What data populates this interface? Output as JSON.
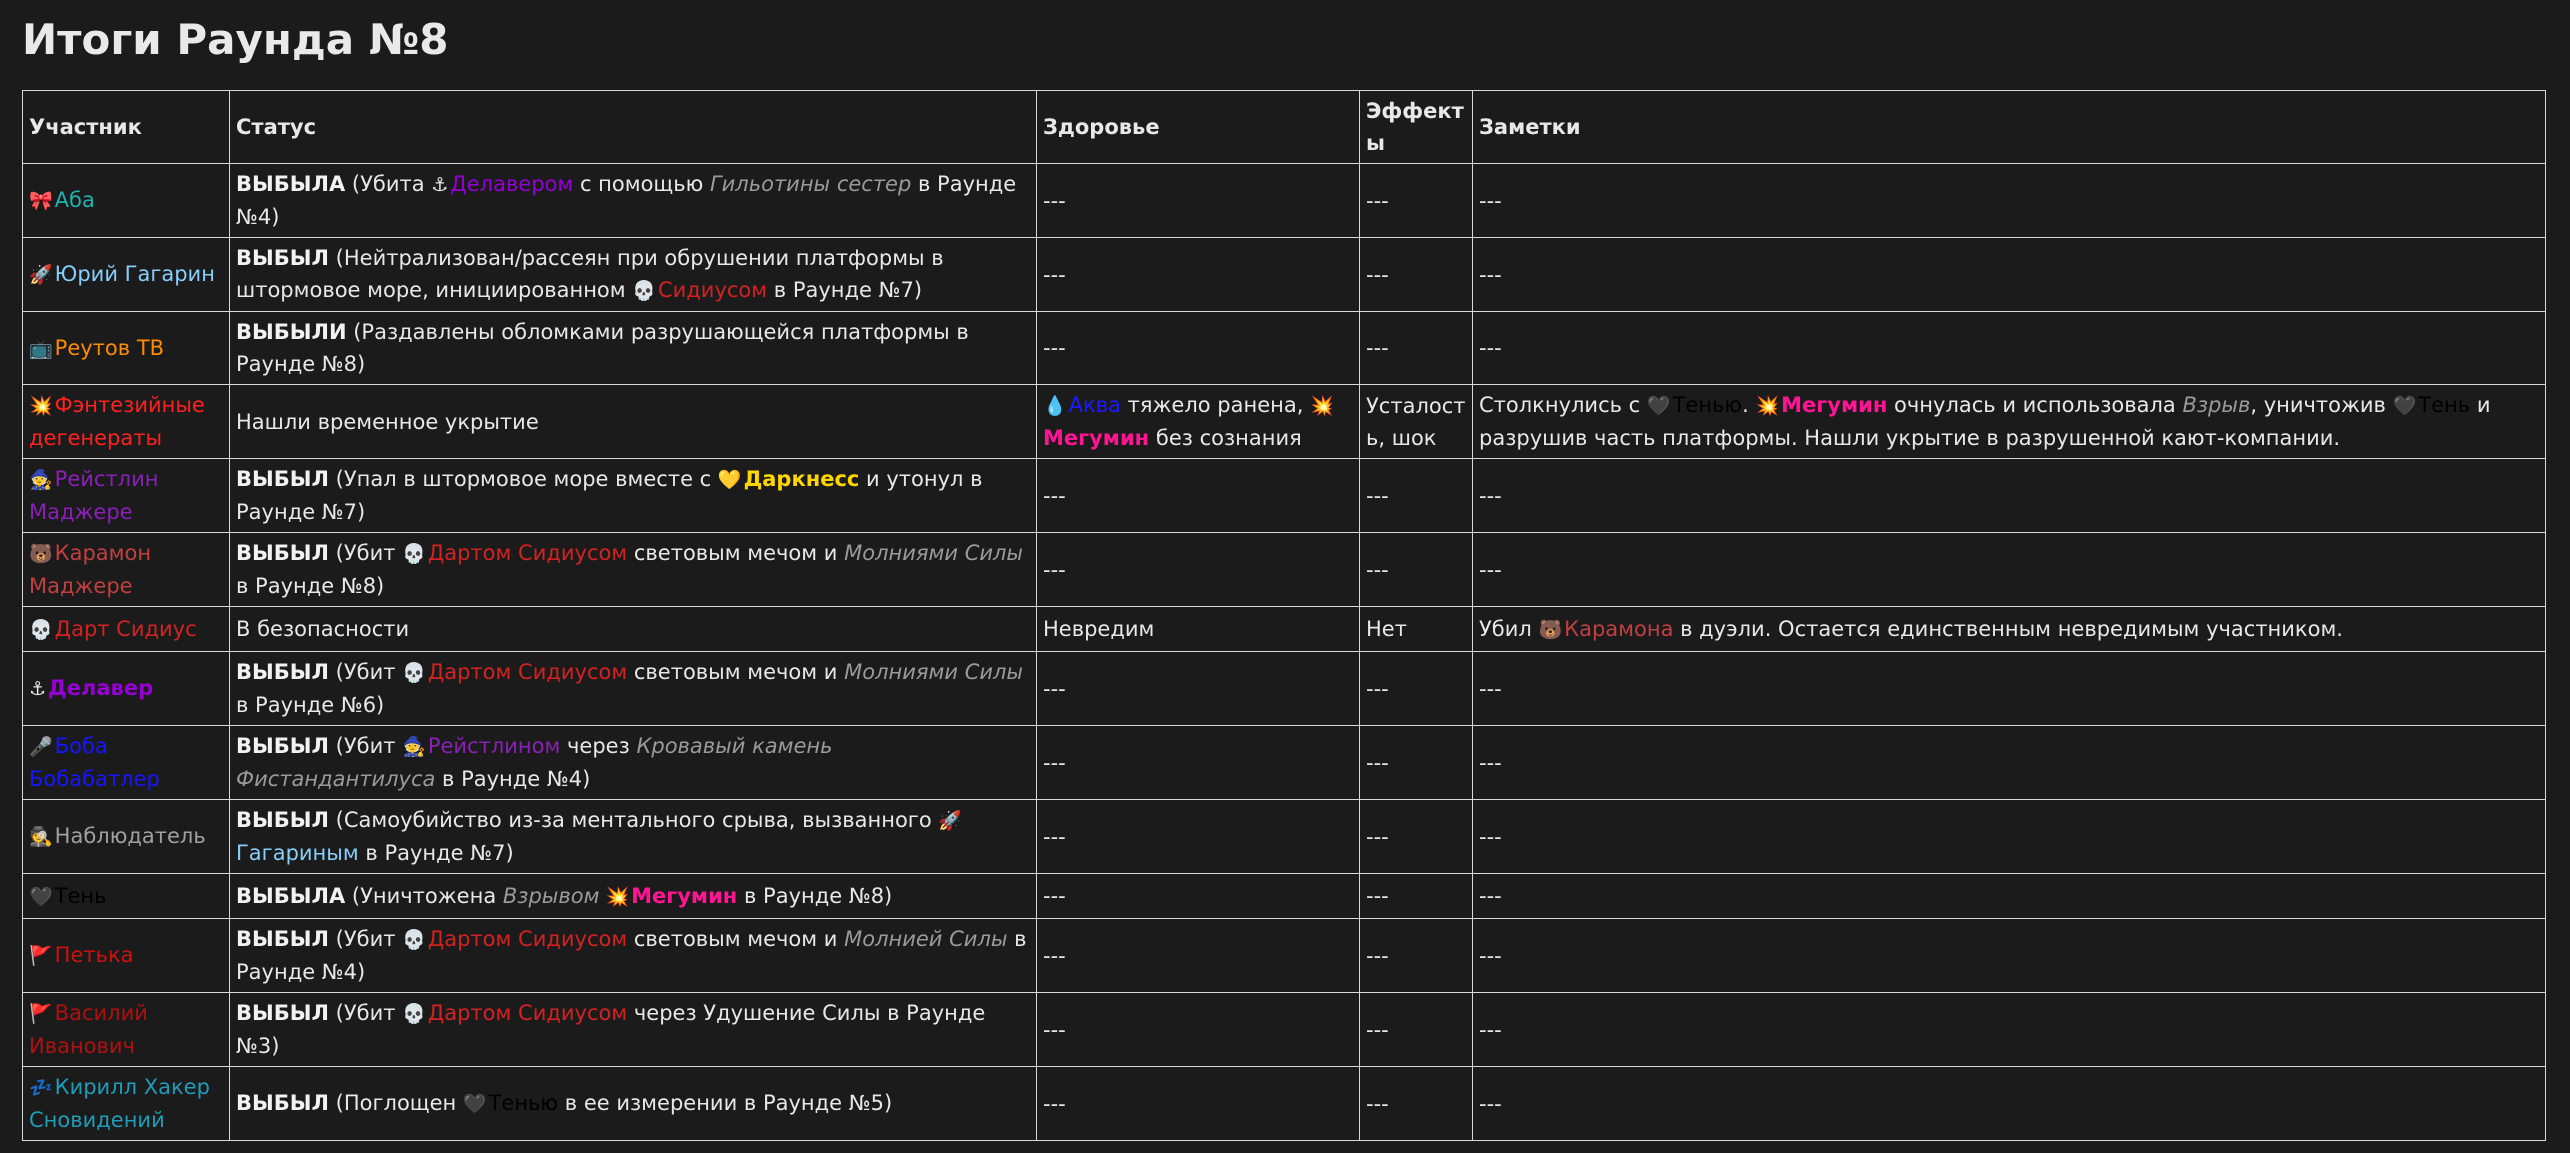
{
  "title": "Итоги Раунда №8",
  "columns": [
    "Участник",
    "Статус",
    "Здоровье",
    "Эффекты",
    "Заметки"
  ],
  "colors": {
    "aba": "#20b2aa",
    "gagarin": "#87cefa",
    "reutov": "#ff8c00",
    "fantasy": "#ff2020",
    "raistlin": "#8b1fb8",
    "caramon": "#c04040",
    "sidious": "#d42222",
    "delaver": "#9400d3",
    "boba": "#1515ff",
    "observer": "#a0a0a0",
    "shadow": "#000000",
    "petka": "#cc1111",
    "vasily": "#b01010",
    "kirill": "#1e9cb8",
    "aqua": "#1a1aff",
    "megumin": "#ff1493",
    "darkness": "#ffd700"
  },
  "rows": [
    {
      "name": {
        "icon": "🎀",
        "icon_name": "ribbon-icon",
        "text": "Аба"
      },
      "status": {
        "s1": "ВЫБЫЛА",
        "s2": " (Убита ",
        "s3_icon": "⚓",
        "s3": "Делавером",
        "s4": " с помощью ",
        "s5": "Гильотины сестер",
        "s6": " в Раунде №4)"
      },
      "health": "---",
      "effects": "---",
      "notes": "---"
    },
    {
      "name": {
        "icon": "🚀",
        "icon_name": "rocket-icon",
        "text": "Юрий Гагарин"
      },
      "status": {
        "s1": "ВЫБЫЛ",
        "s2": " (Нейтрализован/рассеян при обрушении платформы в штормовое море, инициированном ",
        "s3_icon": "💀",
        "s3": "Сидиусом",
        "s4": " в Раунде №7)"
      },
      "health": "---",
      "effects": "---",
      "notes": "---"
    },
    {
      "name": {
        "icon": "📺",
        "icon_name": "tv-icon",
        "text": "Реутов ТВ"
      },
      "status": {
        "s1": "ВЫБЫЛИ",
        "s2": " (Раздавлены обломками разрушающейся платформы в Раунде №8)"
      },
      "health": "---",
      "effects": "---",
      "notes": "---"
    },
    {
      "name": {
        "icon": "💥",
        "icon_name": "explosion-icon",
        "text": "Фэнтезийные дегенераты"
      },
      "status": {
        "s1": "Нашли временное укрытие"
      },
      "health": {
        "h1_icon": "💧",
        "h1": "Аква",
        "h2": " тяжело ранена, ",
        "h3_icon": "💥",
        "h3": "Мегумин",
        "h4": " без сознания"
      },
      "effects": "Усталость, шок",
      "notes": {
        "n1": "Столкнулись с ",
        "n2_icon": "🖤",
        "n2": "Тенью",
        "n3": ". ",
        "n4_icon": "💥",
        "n4": "Мегумин",
        "n5": " очнулась и использовала ",
        "n6": "Взрыв",
        "n7": ", уничтожив ",
        "n8_icon": "🖤",
        "n8": "Тень",
        "n9": " и разрушив часть платформы. Нашли укрытие в разрушенной кают-компании."
      }
    },
    {
      "name": {
        "icon": "🧙",
        "icon_name": "wizard-icon",
        "text": "Рейстлин Маджере"
      },
      "status": {
        "s1": "ВЫБЫЛ",
        "s2": " (Упал в штормовое море вместе с ",
        "s3_icon": "💛",
        "s3": "Даркнесс",
        "s4": " и утонул в Раунде №7)"
      },
      "health": "---",
      "effects": "---",
      "notes": "---"
    },
    {
      "name": {
        "icon": "🐻",
        "icon_name": "bear-icon",
        "text": "Карамон Маджере"
      },
      "status": {
        "s1": "ВЫБЫЛ",
        "s2": " (Убит ",
        "s3_icon": "💀",
        "s3": "Дартом Сидиусом",
        "s4": " световым мечом и ",
        "s5": "Молниями Силы",
        "s6": " в Раунде №8)"
      },
      "health": "---",
      "effects": "---",
      "notes": "---"
    },
    {
      "name": {
        "icon": "💀",
        "icon_name": "skull-icon",
        "text": "Дарт Сидиус"
      },
      "status": {
        "s1": "В безопасности"
      },
      "health": "Невредим",
      "effects": "Нет",
      "notes": {
        "n1": "Убил ",
        "n2_icon": "🐻",
        "n2": "Карамона",
        "n3": " в дуэли. Остается единственным невредимым участником."
      }
    },
    {
      "name": {
        "icon": "⚓",
        "icon_name": "anchor-icon",
        "text": "Делавер"
      },
      "status": {
        "s1": "ВЫБЫЛ",
        "s2": " (Убит ",
        "s3_icon": "💀",
        "s3": "Дартом Сидиусом",
        "s4": " световым мечом и ",
        "s5": "Молниями Силы",
        "s6": " в Раунде №6)"
      },
      "health": "---",
      "effects": "---",
      "notes": "---"
    },
    {
      "name": {
        "icon": "🎤",
        "icon_name": "microphone-icon",
        "text": "Боба Бобабатлер"
      },
      "status": {
        "s1": "ВЫБЫЛ",
        "s2": " (Убит ",
        "s3_icon": "🧙",
        "s3": "Рейстлином",
        "s4": " через ",
        "s5": "Кровавый камень Фистандантилуса",
        "s6": " в Раунде №4)"
      },
      "health": "---",
      "effects": "---",
      "notes": "---"
    },
    {
      "name": {
        "icon": "🕵",
        "icon_name": "detective-icon",
        "text": "Наблюдатель"
      },
      "status": {
        "s1": "ВЫБЫЛ",
        "s2": " (Самоубийство из-за ментального срыва, вызванного ",
        "s3_icon": "🚀",
        "s3": "Гагариным",
        "s4": " в Раунде №7)"
      },
      "health": "---",
      "effects": "---",
      "notes": "---"
    },
    {
      "name": {
        "icon": "🖤",
        "icon_name": "black-heart-icon",
        "text": "Тень"
      },
      "status": {
        "s1": "ВЫБЫЛА",
        "s2": " (Уничтожена ",
        "s3": "Взрывом",
        "s4_icon": "💥",
        "s4": "Мегумин",
        "s5": " в Раунде №8)"
      },
      "health": "---",
      "effects": "---",
      "notes": "---"
    },
    {
      "name": {
        "icon": "🚩",
        "icon_name": "flag-icon",
        "text": "Петька"
      },
      "status": {
        "s1": "ВЫБЫЛ",
        "s2": " (Убит ",
        "s3_icon": "💀",
        "s3": "Дартом Сидиусом",
        "s4": " световым мечом и ",
        "s5": "Молнией Силы",
        "s6": " в Раунде №4)"
      },
      "health": "---",
      "effects": "---",
      "notes": "---"
    },
    {
      "name": {
        "icon": "🚩",
        "icon_name": "flag-icon",
        "text": "Василий Иванович"
      },
      "status": {
        "s1": "ВЫБЫЛ",
        "s2": " (Убит ",
        "s3_icon": "💀",
        "s3": "Дартом Сидиусом",
        "s4": " через Удушение Силы в Раунде №3)"
      },
      "health": "---",
      "effects": "---",
      "notes": "---"
    },
    {
      "name": {
        "icon": "💤",
        "icon_name": "sleep-icon",
        "text": "Кирилл Хакер Сновидений"
      },
      "status": {
        "s1": "ВЫБЫЛ",
        "s2": " (Поглощен ",
        "s3_icon": "🖤",
        "s3": "Тенью",
        "s4": " в ее измерении в Раунде №5)"
      },
      "health": "---",
      "effects": "---",
      "notes": "---"
    }
  ]
}
